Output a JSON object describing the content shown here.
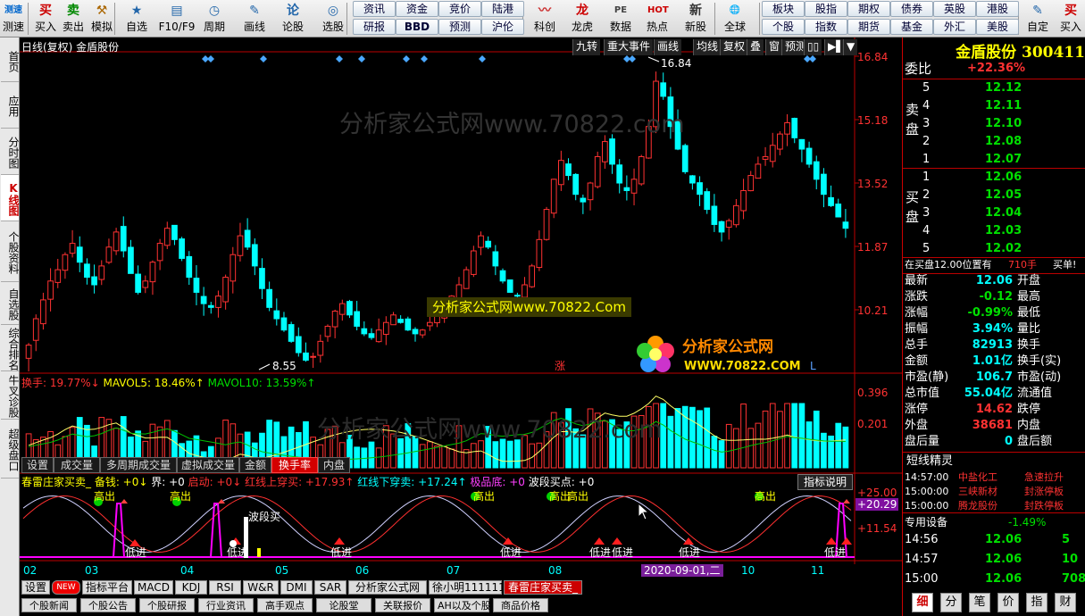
{
  "toolbar": {
    "items": [
      {
        "label": "测速",
        "icon": "测速",
        "icon_name": "speed-test-icon"
      },
      {
        "label": "买入",
        "icon": "买",
        "icon_name": "buy-icon"
      },
      {
        "label": "卖出",
        "icon": "卖",
        "icon_name": "sell-icon"
      },
      {
        "label": "模拟",
        "icon": "⚒",
        "icon_name": "simulate-icon"
      },
      {
        "label": "自选",
        "icon": "★",
        "icon_name": "watchlist-icon"
      },
      {
        "label": "F10/F9",
        "icon": "▤",
        "icon_name": "f10-icon"
      },
      {
        "label": "周期",
        "icon": "◷",
        "icon_name": "period-icon"
      },
      {
        "label": "画线",
        "icon": "✎",
        "icon_name": "draw-line-icon"
      },
      {
        "label": "论股",
        "icon": "论",
        "icon_name": "forum-icon"
      },
      {
        "label": "选股",
        "icon": "◎",
        "icon_name": "stock-picker-icon"
      },
      {
        "label": "科创",
        "icon": "〰",
        "icon_name": "star-market-icon"
      },
      {
        "label": "龙虎",
        "icon": "龙",
        "icon_name": "dragon-tiger-icon"
      },
      {
        "label": "数据",
        "icon": "PE",
        "icon_name": "data-icon"
      },
      {
        "label": "热点",
        "icon": "HOT",
        "icon_name": "hot-icon"
      },
      {
        "label": "新股",
        "icon": "新",
        "icon_name": "new-stock-icon"
      },
      {
        "label": "全球",
        "icon": "🌐",
        "icon_name": "globe-icon"
      },
      {
        "label": "自定",
        "icon": "✎",
        "icon_name": "custom-icon"
      },
      {
        "label": "买入",
        "icon": "买",
        "icon_name": "buy-icon-2"
      }
    ],
    "quick": [
      [
        "资讯",
        "资金",
        "竞价",
        "陆港"
      ],
      [
        "研报",
        "BBD",
        "预测",
        "沪伦"
      ],
      [
        "板块",
        "股指",
        "期权",
        "债券",
        "英股",
        "港股"
      ],
      [
        "个股",
        "指数",
        "期货",
        "基金",
        "外汇",
        "美股"
      ]
    ]
  },
  "leftnav": [
    "首页",
    "应用",
    "分时图",
    "K线图",
    "个股资料",
    "自选股",
    "综合排名",
    "牛叉诊股",
    "超级盘口"
  ],
  "chart": {
    "title": "日线(复权)  金盾股份",
    "top_buttons": [
      "九转",
      "重大事件",
      "画线",
      "均线",
      "复权",
      "叠",
      "窗",
      "预测",
      "▯▯",
      "▶▌",
      "▼"
    ],
    "price_labels": [
      "16.84",
      "15.18",
      "13.52",
      "11.87",
      "10.21"
    ],
    "high_label": "16.84",
    "low_label": "8.55",
    "watermark": "分析家公式网www.70822.com",
    "banner": "分析家公式网www.70822.Com",
    "logo_text": "分析家公式网",
    "logo_url": "WWW.70822.COM",
    "zhang": "涨",
    "L": "L",
    "vol_legend": {
      "a": "换手: 19.77%↓",
      "b": "MAVOL5: 18.46%↑",
      "c": "MAVOL10: 13.59%↑"
    },
    "vol_labels": [
      "0.396",
      "0.201"
    ],
    "vol_tabs": [
      "设置",
      "成交量",
      "多周期成交量",
      "虚拟成交量",
      "金额",
      "换手率",
      "内盘"
    ],
    "ind_legend": {
      "a": "春雷庄家买卖_ 备钱: +0↓",
      "b": "界: +0",
      "c": "启动: +0↓",
      "d": "红线上穿买: +17.93↑",
      "e": "红线下穿卖: +17.24↑",
      "f": "极品底: +0",
      "g": "波段买点: +0"
    },
    "ind_help": "指标说明",
    "ind_labels": [
      "+25.00",
      "+20.29",
      "+11.54"
    ],
    "ind_texts": {
      "sell": "高出",
      "buy": "低进",
      "band": "波段买"
    },
    "months": [
      "02",
      "03",
      "04",
      "05",
      "06",
      "07",
      "08",
      "10",
      "11"
    ],
    "cursor_date": "2020-09-01,二",
    "bottom_tabs": [
      "设置",
      "NEW",
      "指标平台",
      "MACD",
      "KDJ",
      "RSI",
      "W&R",
      "DMI",
      "SAR",
      "分析家公式网",
      "徐小明111111",
      "春雷庄家买卖_"
    ],
    "bottom_tabs2": [
      "个股新闻",
      "个股公告",
      "个股研报",
      "行业资讯",
      "高手观点",
      "论股堂",
      "关联报价",
      "AH以及个股",
      "商品价格"
    ]
  },
  "chart_data": {
    "type": "candlestick",
    "ylim": [
      8.55,
      16.84
    ],
    "closes": [
      9.2,
      9.9,
      10.4,
      10.9,
      11.2,
      11.6,
      11.9,
      11.4,
      11.0,
      10.8,
      11.3,
      11.8,
      12.2,
      11.7,
      11.1,
      10.6,
      10.9,
      11.4,
      11.9,
      12.3,
      12.0,
      11.5,
      11.0,
      10.6,
      10.3,
      10.2,
      10.5,
      11.0,
      11.6,
      12.1,
      11.8,
      11.3,
      10.7,
      10.2,
      9.9,
      9.6,
      9.3,
      9.0,
      8.8,
      8.9,
      9.3,
      9.7,
      10.1,
      10.3,
      10.0,
      9.7,
      9.5,
      9.4,
      9.6,
      9.8,
      10.0,
      9.8,
      9.6,
      9.5,
      9.6,
      9.8,
      10.0,
      10.3,
      10.5,
      10.8,
      11.2,
      11.7,
      12.1,
      11.8,
      11.3,
      10.9,
      10.6,
      10.5,
      10.8,
      11.3,
      12.0,
      12.8,
      13.6,
      14.1,
      13.7,
      13.2,
      13.0,
      13.5,
      14.2,
      14.6,
      14.0,
      13.5,
      13.3,
      13.6,
      14.2,
      15.0,
      16.2,
      15.8,
      15.0,
      14.4,
      13.8,
      13.5,
      13.2,
      12.8,
      12.4,
      12.2,
      12.5,
      12.9,
      13.3,
      13.7,
      14.0,
      14.2,
      14.5,
      14.8,
      15.1,
      14.7,
      14.4,
      14.0,
      13.6,
      13.2,
      12.9,
      12.6,
      12.3
    ],
    "turnover_ma5": 18.46,
    "turnover_ma10": 13.59,
    "turnover": 19.77
  },
  "right": {
    "name": "金盾股份 300411",
    "webi_label": "委比",
    "webi": "+22.36%",
    "sell_label": "卖盘",
    "buy_label": "买盘",
    "sells": [
      [
        "5",
        "12.12"
      ],
      [
        "4",
        "12.11"
      ],
      [
        "3",
        "12.10"
      ],
      [
        "2",
        "12.08"
      ],
      [
        "1",
        "12.07"
      ]
    ],
    "buys": [
      [
        "1",
        "12.06"
      ],
      [
        "2",
        "12.05"
      ],
      [
        "3",
        "12.04"
      ],
      [
        "4",
        "12.03"
      ],
      [
        "5",
        "12.02"
      ]
    ],
    "buy_note": "在买盘12.00位置有",
    "buy_note_qty": "710手",
    "buy_note_tag": "买单!",
    "quotes": [
      [
        "最新",
        "12.06",
        "开盘"
      ],
      [
        "涨跌",
        "-0.12",
        "最高"
      ],
      [
        "涨幅",
        "-0.99%",
        "最低"
      ],
      [
        "振幅",
        "3.94%",
        "量比"
      ],
      [
        "总手",
        "82913",
        "换手"
      ],
      [
        "金额",
        "1.01亿",
        "换手(实)"
      ],
      [
        "市盈(静)",
        "106.7",
        "市盈(动)"
      ],
      [
        "总市值",
        "55.04亿",
        "流通值"
      ],
      [
        "涨停",
        "14.62",
        "跌停"
      ],
      [
        "外盘",
        "38681",
        "内盘"
      ],
      [
        "盘后量",
        "0",
        "盘后额"
      ]
    ],
    "spirit_title": "短线精灵",
    "spirit": [
      [
        "14:57:00",
        "中盐化工",
        "急速拉升"
      ],
      [
        "15:00:00",
        "三峡新材",
        "封涨停板"
      ],
      [
        "15:00:00",
        "腾龙股份",
        "封跌停板"
      ]
    ],
    "equip_label": "专用设备",
    "equip_pct": "-1.49%",
    "ticks": [
      [
        "14:56",
        "12.06",
        "5"
      ],
      [
        "14:57",
        "12.06",
        "10"
      ],
      [
        "15:00",
        "12.06",
        "708"
      ]
    ],
    "btabs": [
      "细",
      "分",
      "笔",
      "价",
      "指",
      "财"
    ]
  },
  "colors": {
    "up": "#ff3232",
    "down": "#00ffff",
    "accent": "#c00000"
  }
}
